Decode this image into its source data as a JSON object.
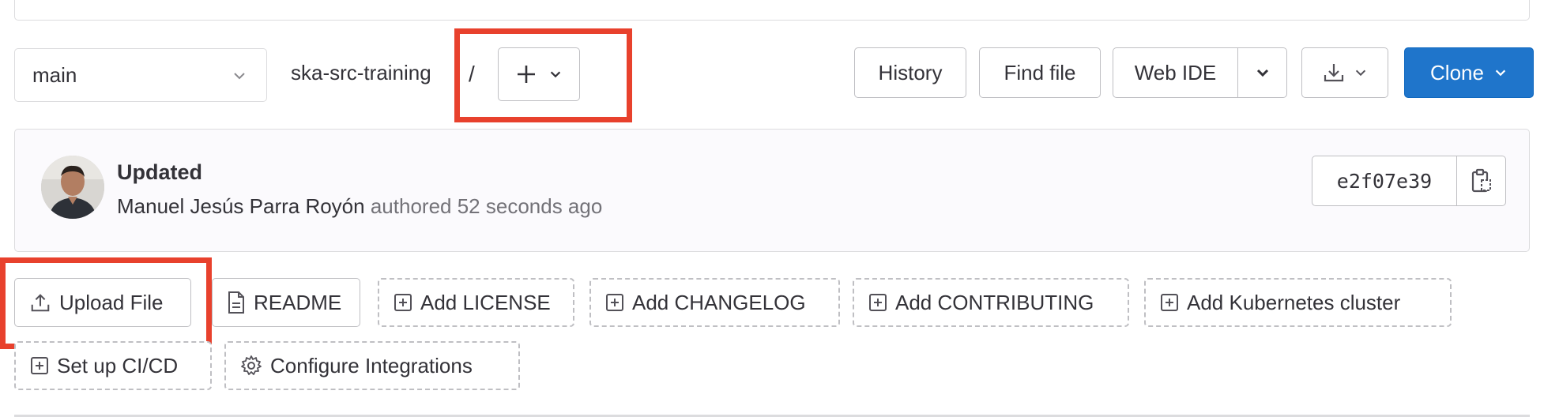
{
  "branch": {
    "name": "main"
  },
  "breadcrumb": {
    "repo": "ska-src-training",
    "separator": "/"
  },
  "toolbar": {
    "history": "History",
    "find_file": "Find file",
    "web_ide": "Web IDE",
    "clone": "Clone"
  },
  "commit": {
    "title": "Updated",
    "author": "Manuel Jesús Parra Royón",
    "meta": "authored 52 seconds ago",
    "sha": "e2f07e39"
  },
  "quick_actions": {
    "upload_file": "Upload File",
    "readme": "README",
    "add_license": "Add LICENSE",
    "add_changelog": "Add CHANGELOG",
    "add_contributing": "Add CONTRIBUTING",
    "add_kubernetes": "Add Kubernetes cluster",
    "setup_cicd": "Set up CI/CD",
    "configure_integrations": "Configure Integrations"
  },
  "icons": {
    "chevron": "chevron-down-icon",
    "plus": "plus-icon",
    "download": "download-icon",
    "copy": "clipboard-icon",
    "upload": "upload-icon",
    "doc": "document-icon",
    "add": "plus-square-icon",
    "gear": "gear-icon"
  },
  "colors": {
    "highlight": "#e8412d",
    "clone_bg": "#1f75cb"
  }
}
